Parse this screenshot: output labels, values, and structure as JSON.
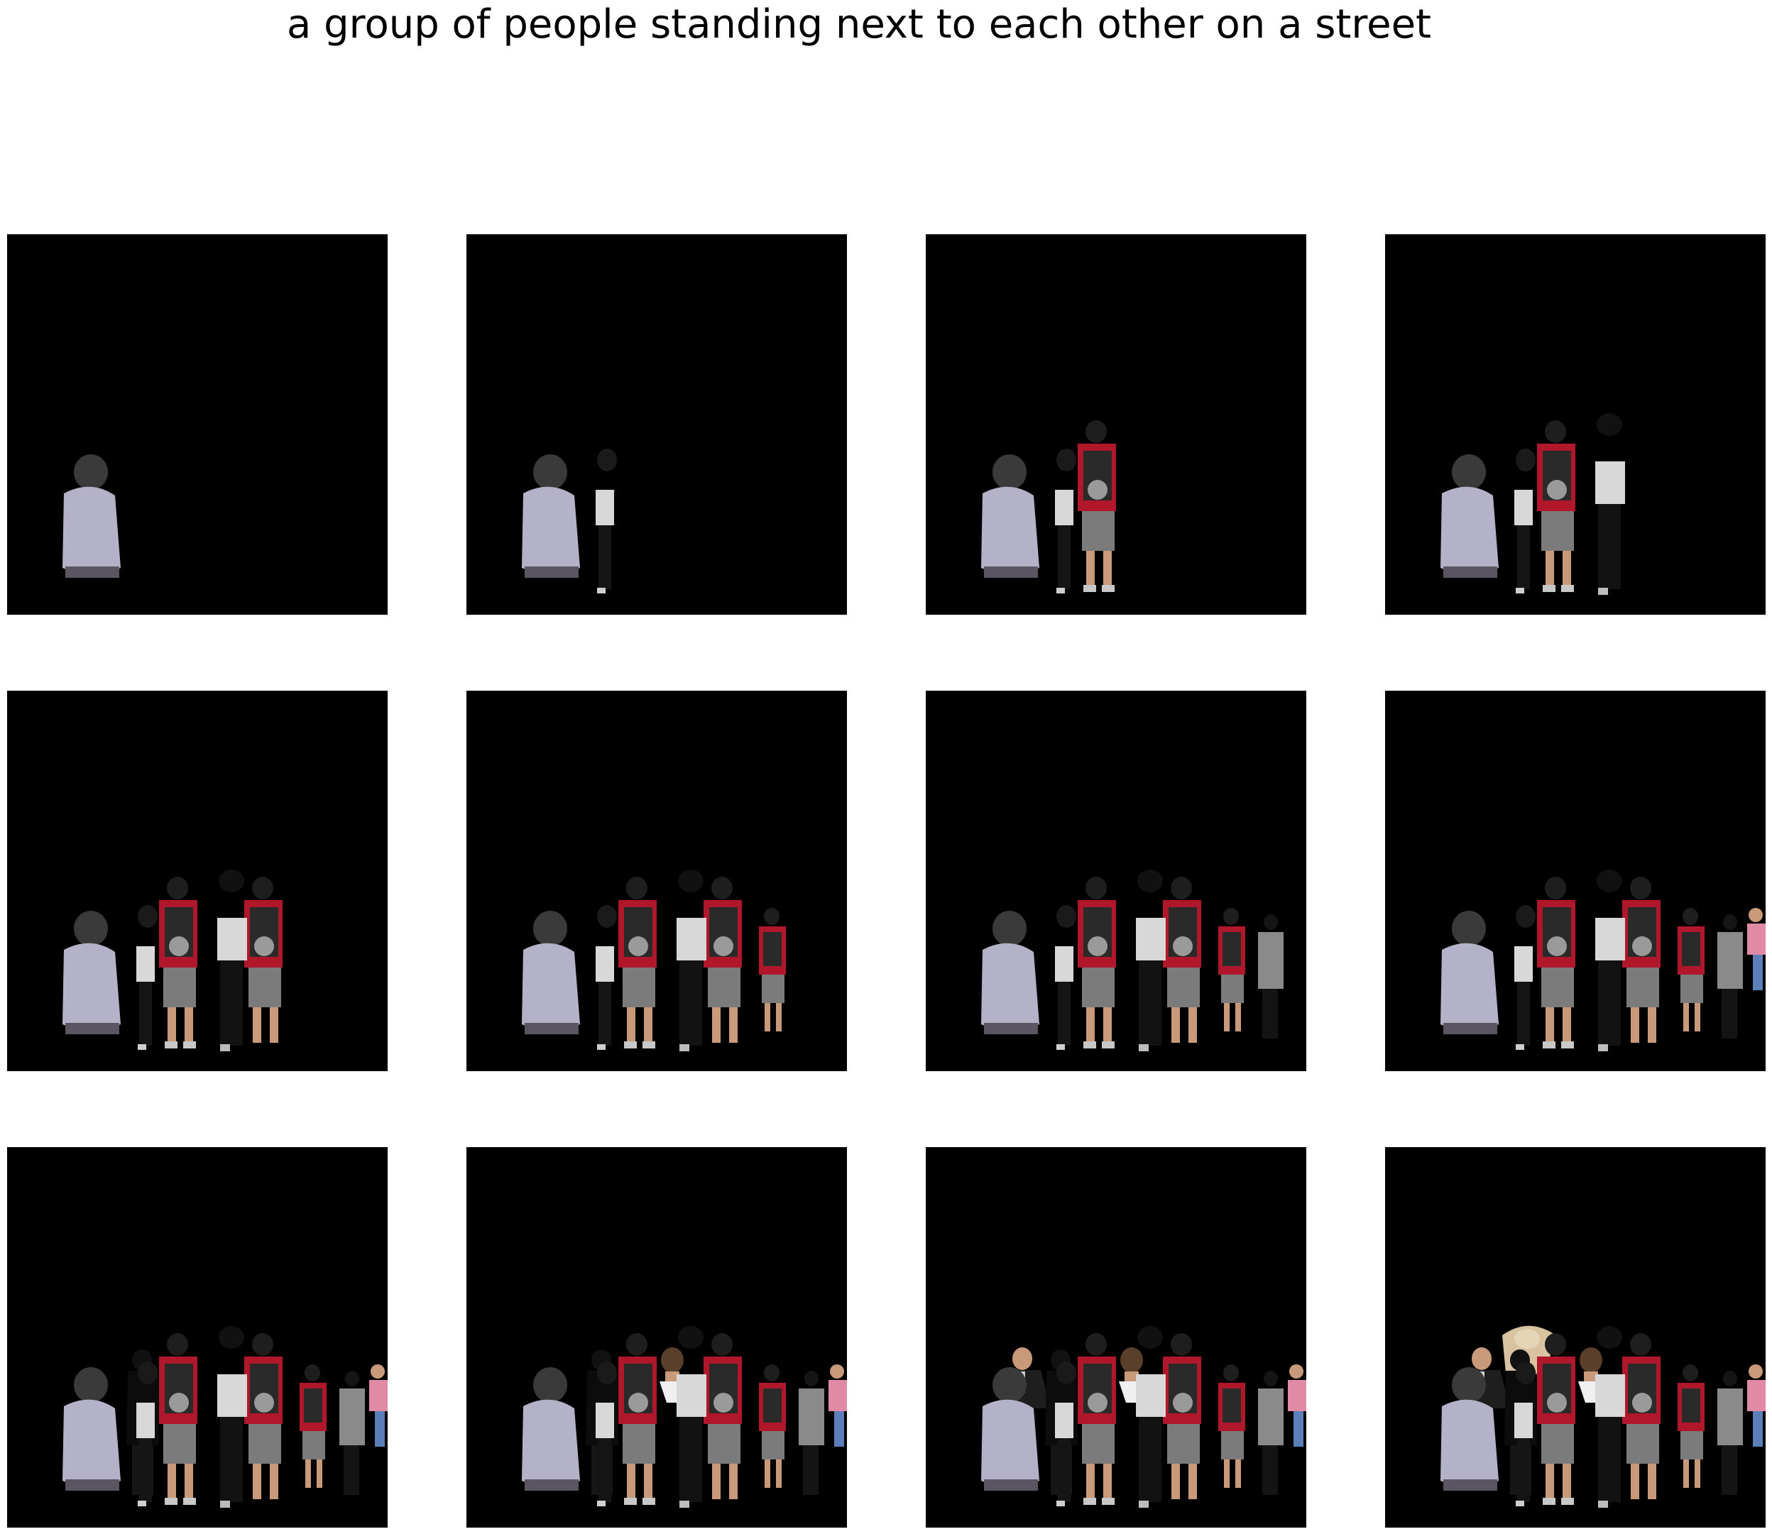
{
  "figure": {
    "title": "a group of people standing next to each other on a street"
  },
  "panels": [
    {
      "step": 1,
      "people": [
        "person-gray-hoodie-seated"
      ]
    },
    {
      "step": 2,
      "people": [
        "person-gray-hoodie-seated",
        "person-dark-small"
      ]
    },
    {
      "step": 3,
      "people": [
        "person-gray-hoodie-seated",
        "person-dark-small",
        "person-red-shirt-backpack-1"
      ]
    },
    {
      "step": 4,
      "people": [
        "person-gray-hoodie-seated",
        "person-dark-small",
        "person-red-shirt-backpack-1",
        "person-white-top-black-pants"
      ]
    },
    {
      "step": 5,
      "people": [
        "person-gray-hoodie-seated",
        "person-dark-small",
        "person-red-shirt-backpack-1",
        "person-white-top-black-pants",
        "person-red-shirt-backpack-2"
      ]
    },
    {
      "step": 6,
      "people": [
        "person-gray-hoodie-seated",
        "person-dark-small",
        "person-red-shirt-backpack-1",
        "person-white-top-black-pants",
        "person-red-shirt-backpack-2",
        "person-red-shirt-child"
      ]
    },
    {
      "step": 7,
      "people": [
        "person-gray-hoodie-seated",
        "person-dark-small",
        "person-red-shirt-backpack-1",
        "person-white-top-black-pants",
        "person-red-shirt-backpack-2",
        "person-red-shirt-child",
        "person-gray-jacket"
      ]
    },
    {
      "step": 8,
      "people": [
        "person-gray-hoodie-seated",
        "person-dark-small",
        "person-red-shirt-backpack-1",
        "person-white-top-black-pants",
        "person-red-shirt-backpack-2",
        "person-red-shirt-child",
        "person-gray-jacket",
        "person-pink-shirt"
      ]
    },
    {
      "step": 9,
      "people": [
        "person-gray-hoodie-seated",
        "person-dark-small",
        "person-red-shirt-backpack-1",
        "person-white-top-black-pants",
        "person-red-shirt-backpack-2",
        "person-red-shirt-child",
        "person-gray-jacket",
        "person-pink-shirt",
        "person-dark-coat"
      ]
    },
    {
      "step": 10,
      "people": [
        "person-gray-hoodie-seated",
        "person-dark-small",
        "person-red-shirt-backpack-1",
        "person-white-top-black-pants",
        "person-red-shirt-backpack-2",
        "person-red-shirt-child",
        "person-gray-jacket",
        "person-pink-shirt",
        "person-dark-coat",
        "person-long-hair"
      ]
    },
    {
      "step": 11,
      "people": [
        "person-gray-hoodie-seated",
        "person-dark-small",
        "person-red-shirt-backpack-1",
        "person-white-top-black-pants",
        "person-red-shirt-backpack-2",
        "person-red-shirt-child",
        "person-gray-jacket",
        "person-pink-shirt",
        "person-dark-coat",
        "person-long-hair",
        "person-suit-man"
      ]
    },
    {
      "step": 12,
      "people": [
        "person-gray-hoodie-seated",
        "person-dark-small",
        "person-red-shirt-backpack-1",
        "person-white-top-black-pants",
        "person-red-shirt-backpack-2",
        "person-red-shirt-child",
        "person-gray-jacket",
        "person-pink-shirt",
        "person-dark-coat",
        "person-long-hair",
        "person-suit-man",
        "person-blond-top"
      ]
    }
  ],
  "colors": {
    "background": "#000000",
    "hoodie": "#b4b2c8",
    "red_shirt": "#b0172b",
    "backpack": "#2a2a2a",
    "shorts": "#7b7b7b",
    "white_top": "#d8d8d8",
    "gray_jacket": "#8a8a8a",
    "pink_shirt": "#e08aa6",
    "skin": "#c99a7a",
    "blond": "#d8c2a0"
  }
}
